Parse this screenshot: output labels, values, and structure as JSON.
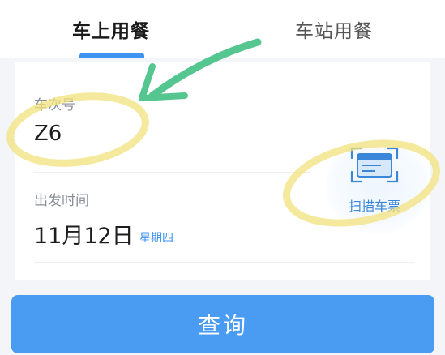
{
  "tabs": [
    {
      "label": "车上用餐",
      "active": true
    },
    {
      "label": "车站用餐",
      "active": false
    }
  ],
  "form": {
    "train_label": "车次号",
    "train_value": "Z6",
    "date_label": "出发时间",
    "date_value": "11月12日",
    "weekday": "星期四"
  },
  "scan": {
    "label": "扫描车票",
    "icon": "ticket-scan-icon"
  },
  "query_button": "查询",
  "colors": {
    "accent": "#3c93f0",
    "button": "#4a9cf3",
    "highlight": "#f4e68e",
    "arrow": "#56c690"
  }
}
